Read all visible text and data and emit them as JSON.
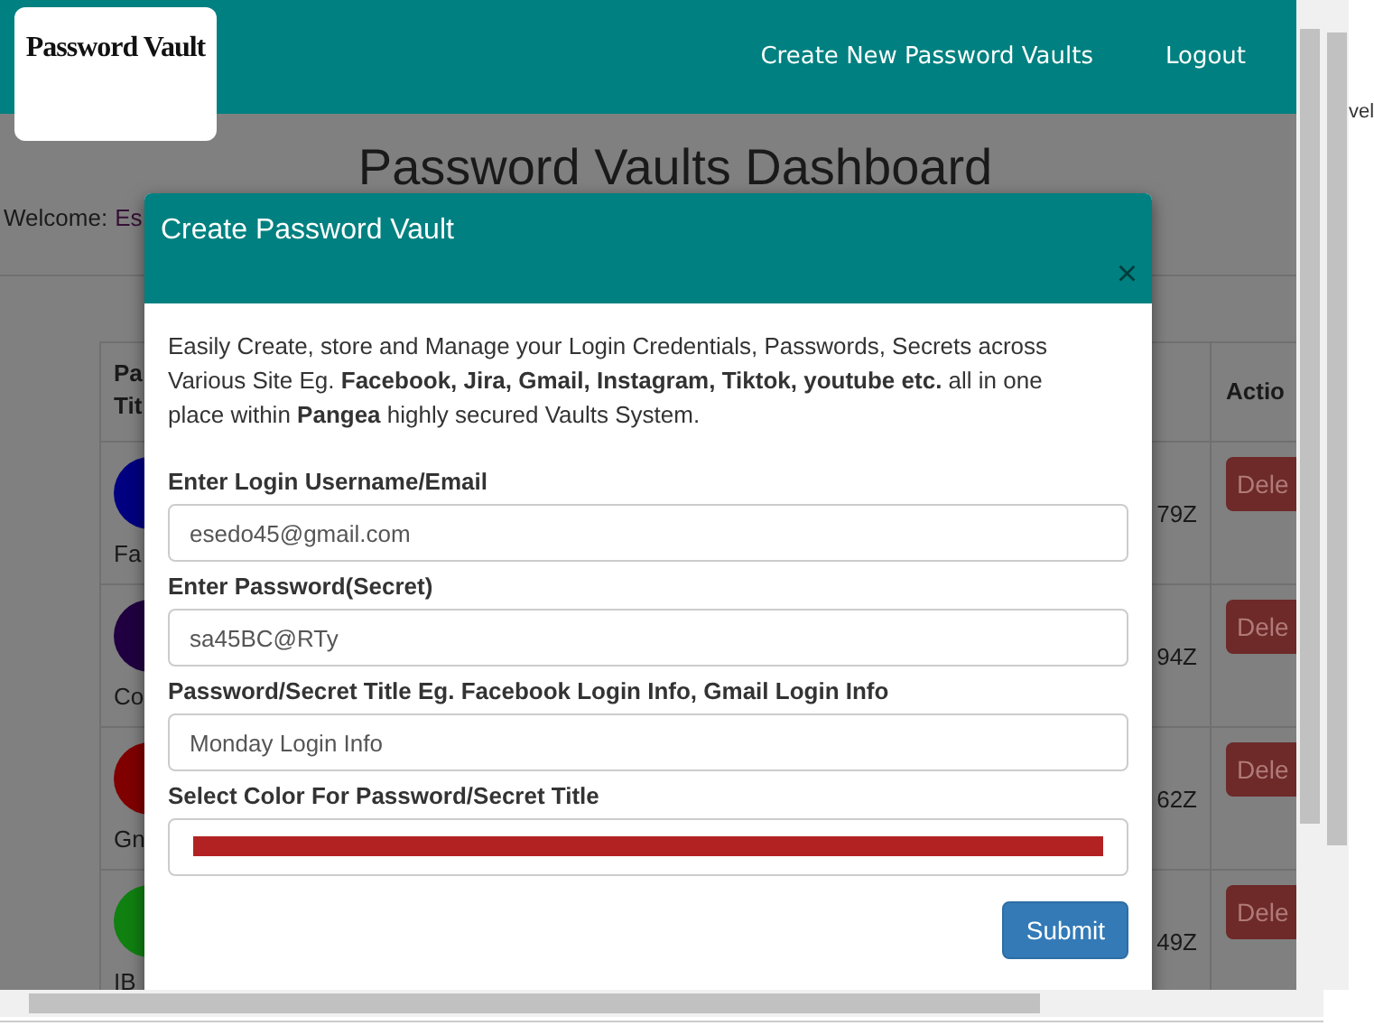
{
  "navbar": {
    "logo": "Password Vault",
    "links": [
      {
        "label": "Create New Password Vaults"
      },
      {
        "label": "Logout"
      }
    ]
  },
  "page": {
    "heading": "Password Vaults Dashboard",
    "welcome": {
      "label": "Welcome:",
      "user": "Es"
    },
    "table": {
      "header": {
        "column_1": [
          "Pa",
          "Tit"
        ],
        "column_3": "Actio"
      },
      "rows": [
        {
          "color": "#000080",
          "title": "Fa",
          "column_2": "79Z",
          "action": "Dele"
        },
        {
          "color": "#200040",
          "title": "Co",
          "column_2": "94Z",
          "action": "Dele"
        },
        {
          "color": "#800000",
          "title": "Gn",
          "column_2": "62Z",
          "action": "Dele"
        },
        {
          "color": "#108010",
          "title": "IB",
          "column_2": "49Z",
          "action": "Dele"
        }
      ]
    }
  },
  "side_text": "vel",
  "modal": {
    "title": "Create Password Vault",
    "close": "×",
    "intro": "Easily Create, store and Manage your Login Credentials, Passwords, Secrets across Various Site Eg. **Facebook, Jira, Gmail, Instagram, Tiktok, youtube etc.** all in one place within **Pangea** highly secured Vaults System.",
    "fields": [
      {
        "kind": "text",
        "label": "Enter Login Username/Email",
        "value": "esedo45@gmail.com"
      },
      {
        "kind": "text",
        "label": "Enter Password(Secret)",
        "value": "sa45BC@RTy"
      },
      {
        "kind": "text",
        "label": "Password/Secret Title Eg. Facebook Login Info, Gmail Login Info",
        "value": "Monday Login Info"
      },
      {
        "kind": "color",
        "label": "Select Color For Password/Secret Title",
        "color": "#b22222"
      }
    ],
    "submit": "Submit"
  }
}
